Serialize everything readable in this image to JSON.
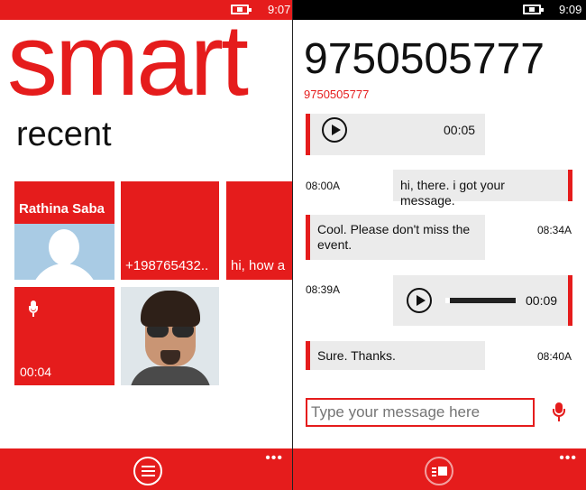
{
  "left_screen": {
    "status": {
      "time": "9:07"
    },
    "app_title": "smart",
    "section_title": "recent",
    "tiles": {
      "contact_name": "Rathina Saba",
      "number_preview": "+198765432..",
      "message_preview": "hi, how a",
      "voice_duration": "00:04"
    },
    "app_bar": {
      "more": "•••"
    }
  },
  "right_screen": {
    "status": {
      "time": "9:09"
    },
    "contact_number": "9750505777",
    "contact_subtitle": "9750505777",
    "messages": [
      {
        "direction": "incoming",
        "type": "audio",
        "duration": "00:05",
        "time": ""
      },
      {
        "direction": "outgoing",
        "type": "text",
        "text": "hi, there. i got your message.",
        "time": "08:00A"
      },
      {
        "direction": "incoming",
        "type": "text",
        "text": "Cool. Please don't miss the event.",
        "time": "08:34A"
      },
      {
        "direction": "outgoing",
        "type": "audio",
        "duration": "00:09",
        "time": "08:39A",
        "progress": 0.06
      },
      {
        "direction": "incoming",
        "type": "text",
        "text": "Sure. Thanks.",
        "time": "08:40A"
      }
    ],
    "composer": {
      "placeholder": "Type your message here"
    },
    "app_bar": {
      "more": "•••"
    }
  },
  "colors": {
    "accent": "#e51c1c",
    "bubble": "#ebebeb",
    "status_dark": "#000000"
  }
}
